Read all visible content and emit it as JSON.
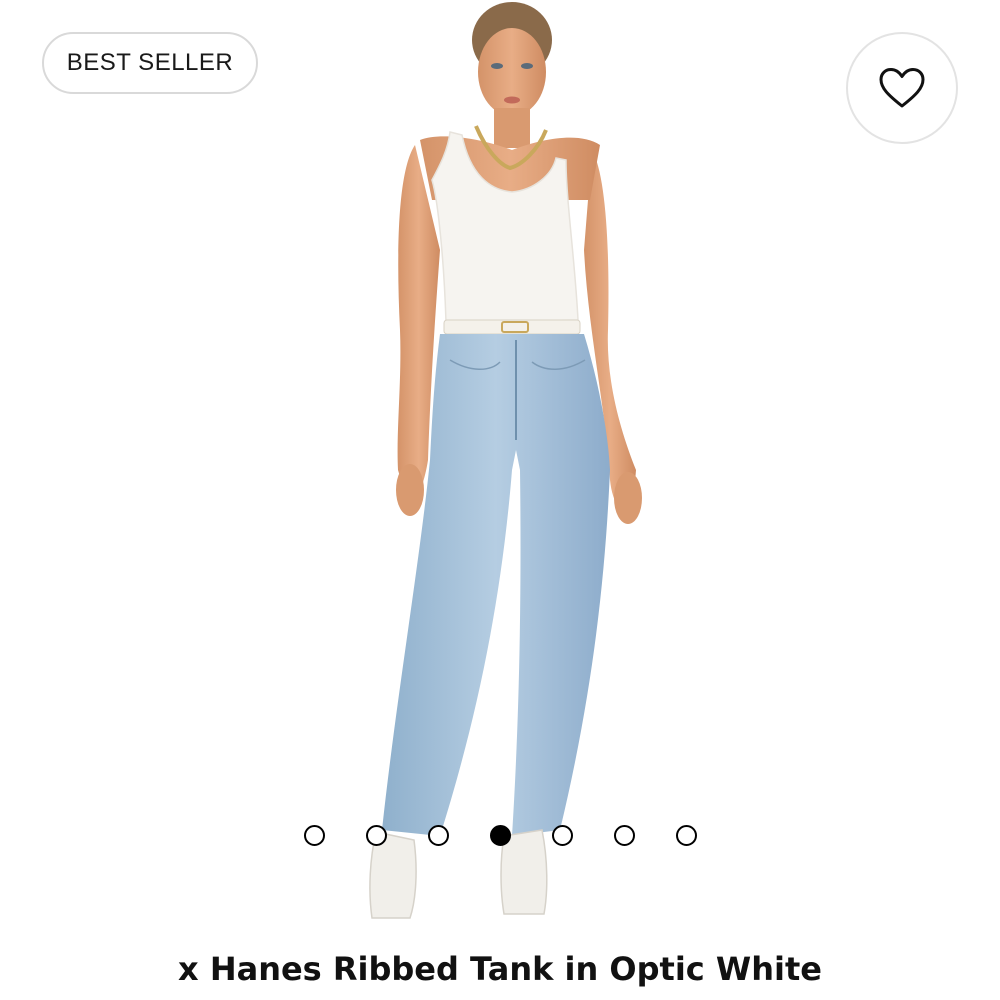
{
  "badge": {
    "label": "BEST SELLER"
  },
  "wishlist": {
    "icon": "heart-outline-icon"
  },
  "carousel": {
    "total_images": 7,
    "active_index": 3
  },
  "product": {
    "title": "x Hanes Ribbed Tank in Optic White"
  },
  "colors": {
    "tank": "#f6f4f0",
    "denim": "#9fbdd6",
    "skin": "#e2a47c",
    "text": "#111111"
  }
}
